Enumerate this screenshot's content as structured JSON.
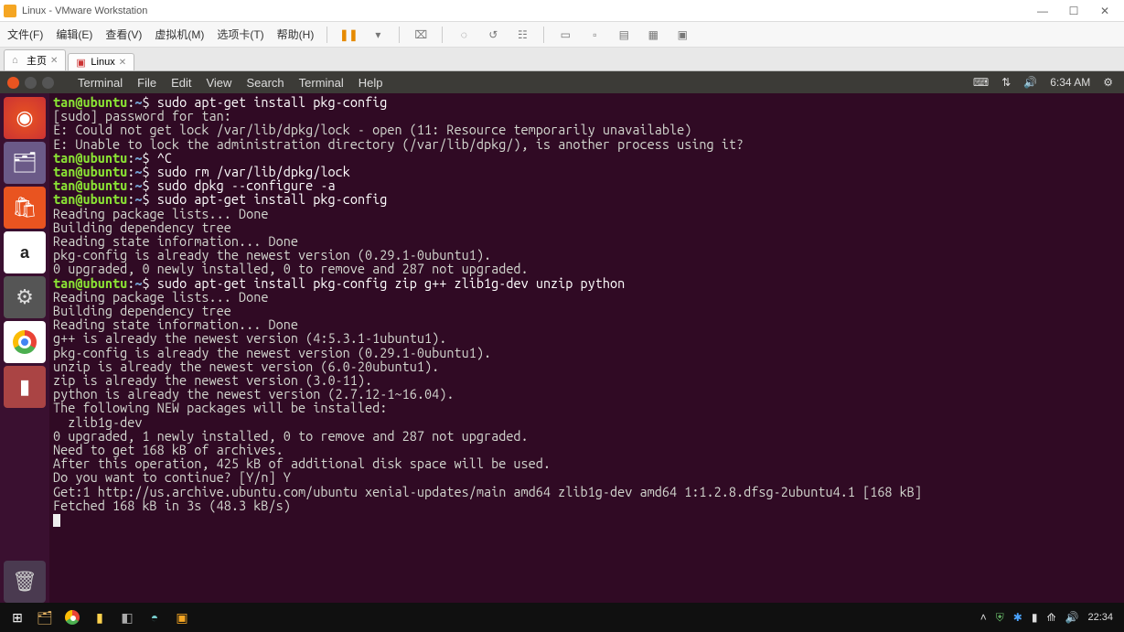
{
  "vmware": {
    "title": "Linux - VMware Workstation",
    "menus": [
      "文件(F)",
      "编辑(E)",
      "查看(V)",
      "虚拟机(M)",
      "选项卡(T)",
      "帮助(H)"
    ],
    "tabs": {
      "home": "主页",
      "vm": "Linux"
    }
  },
  "ubuntu": {
    "appmenu": [
      "Terminal",
      "File",
      "Edit",
      "View",
      "Search",
      "Terminal",
      "Help"
    ],
    "time": "6:34 AM",
    "launcher": {
      "amazon_label": "a"
    }
  },
  "terminal": {
    "user": "tan@ubuntu",
    "pathsym": "~",
    "cmd1": "sudo apt-get install pkg-config",
    "out1a": "[sudo] password for tan:",
    "out1b": "E: Could not get lock /var/lib/dpkg/lock - open (11: Resource temporarily unavailable)",
    "out1c": "E: Unable to lock the administration directory (/var/lib/dpkg/), is another process using it?",
    "cmd2": "^C",
    "cmd3": "sudo rm /var/lib/dpkg/lock",
    "cmd4": "sudo dpkg --configure -a",
    "cmd5": "sudo apt-get install pkg-config",
    "out5a": "Reading package lists... Done",
    "out5b": "Building dependency tree",
    "out5c": "Reading state information... Done",
    "out5d": "pkg-config is already the newest version (0.29.1-0ubuntu1).",
    "out5e": "0 upgraded, 0 newly installed, 0 to remove and 287 not upgraded.",
    "cmd6": "sudo apt-get install pkg-config zip g++ zlib1g-dev unzip python",
    "out6a": "Reading package lists... Done",
    "out6b": "Building dependency tree",
    "out6c": "Reading state information... Done",
    "out6d": "g++ is already the newest version (4:5.3.1-1ubuntu1).",
    "out6e": "pkg-config is already the newest version (0.29.1-0ubuntu1).",
    "out6f": "unzip is already the newest version (6.0-20ubuntu1).",
    "out6g": "zip is already the newest version (3.0-11).",
    "out6h": "python is already the newest version (2.7.12-1~16.04).",
    "out6i": "The following NEW packages will be installed:",
    "out6j": "  zlib1g-dev",
    "out6k": "0 upgraded, 1 newly installed, 0 to remove and 287 not upgraded.",
    "out6l": "Need to get 168 kB of archives.",
    "out6m": "After this operation, 425 kB of additional disk space will be used.",
    "out6n": "Do you want to continue? [Y/n] Y",
    "out6o": "Get:1 http://us.archive.ubuntu.com/ubuntu xenial-updates/main amd64 zlib1g-dev amd64 1:1.2.8.dfsg-2ubuntu4.1 [168 kB]",
    "out6p": "Fetched 168 kB in 3s (48.3 kB/s)"
  },
  "windows": {
    "clock": "22:34"
  }
}
